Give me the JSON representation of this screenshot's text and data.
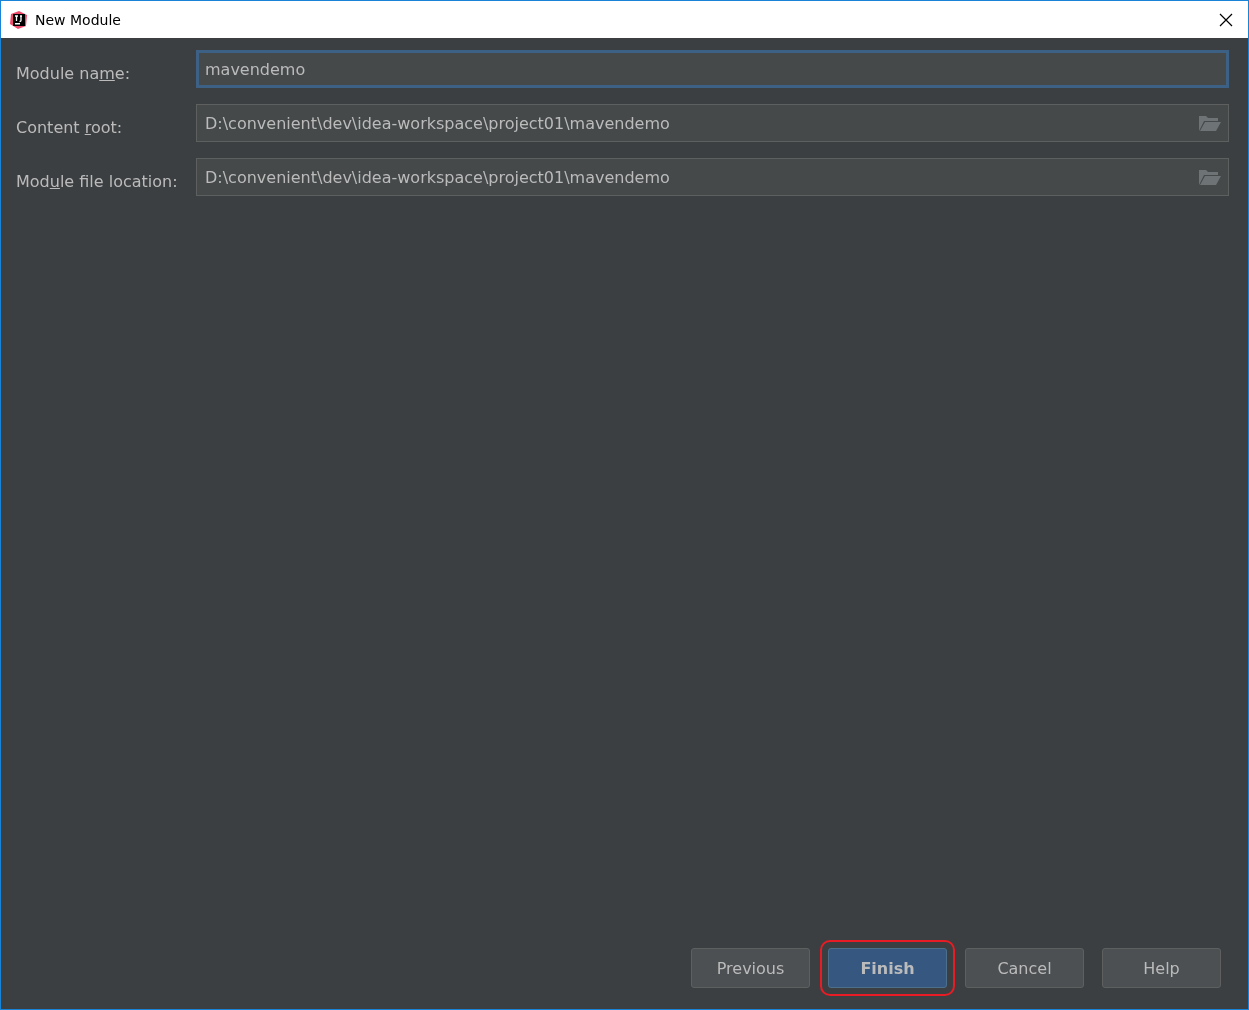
{
  "window": {
    "title": "New Module"
  },
  "fields": [
    {
      "label_parts": [
        "Module na",
        "m",
        "e:"
      ],
      "value": "mavendemo",
      "focused": true,
      "browse": false
    },
    {
      "label_parts": [
        "Content ",
        "r",
        "oot:"
      ],
      "value": "D:\\convenient\\dev\\idea-workspace\\project01\\mavendemo",
      "focused": false,
      "browse": true
    },
    {
      "label_parts": [
        "Mod",
        "u",
        "le file location:"
      ],
      "value": "D:\\convenient\\dev\\idea-workspace\\project01\\mavendemo",
      "focused": false,
      "browse": true
    }
  ],
  "buttons": [
    {
      "label": "Previous",
      "default": false,
      "highlighted": false
    },
    {
      "label": "Finish",
      "default": true,
      "highlighted": true
    },
    {
      "label": "Cancel",
      "default": false,
      "highlighted": false
    },
    {
      "label": "Help",
      "default": false,
      "highlighted": false
    }
  ]
}
